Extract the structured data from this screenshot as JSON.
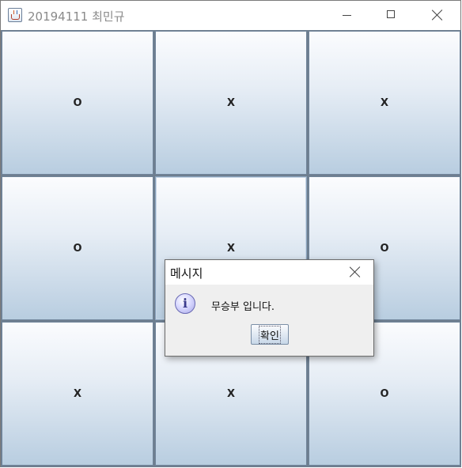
{
  "window": {
    "title": "20194111 최민규",
    "icon": "java-cup-icon"
  },
  "board": {
    "cells": [
      "O",
      "X",
      "X",
      "O",
      "X",
      "O",
      "X",
      "X",
      "O"
    ]
  },
  "dialog": {
    "title": "메시지",
    "message": "무승부 입니다.",
    "ok_label": "확인",
    "icon": "information-icon"
  }
}
